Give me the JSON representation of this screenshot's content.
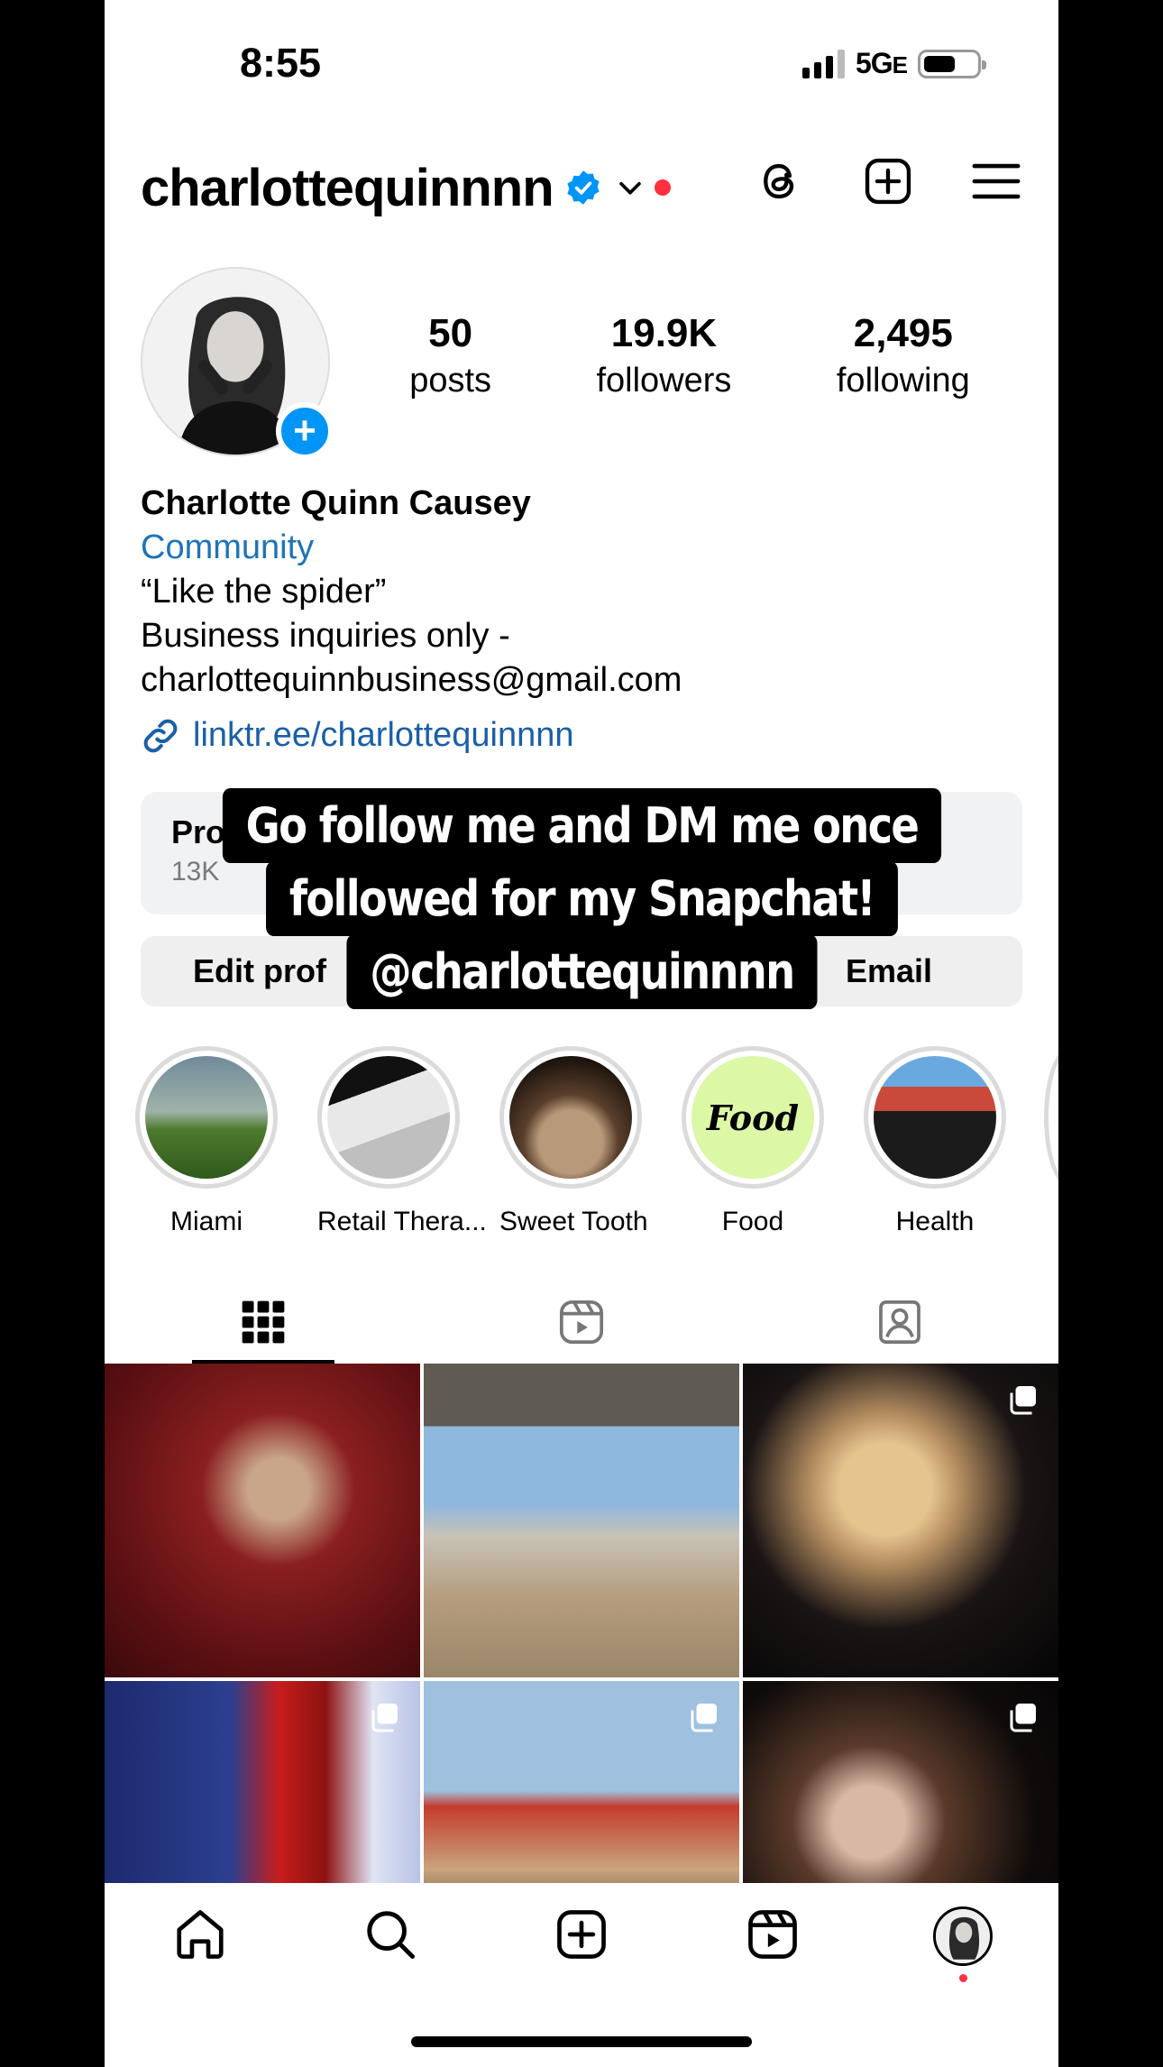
{
  "status_bar": {
    "time": "8:55",
    "network": "5G",
    "network_suffix": "E"
  },
  "header": {
    "username": "charlottequinnnn"
  },
  "stats": [
    {
      "value": "50",
      "label": "posts"
    },
    {
      "value": "19.9K",
      "label": "followers"
    },
    {
      "value": "2,495",
      "label": "following"
    }
  ],
  "bio": {
    "name": "Charlotte Quinn Causey",
    "category": "Community",
    "line1": "“Like the spider”",
    "line2": "Business inquiries only -",
    "line3": "charlottequinnbusiness@gmail.com",
    "link": "linktr.ee/charlottequinnnn"
  },
  "dashboard": {
    "title": "Pro",
    "subtitle": "13K"
  },
  "buttons": {
    "edit": "Edit prof",
    "email": "Email"
  },
  "sticker": {
    "line1": "Go follow me and DM me once",
    "line2": "followed for my Snapchat!",
    "line3": "@charlottequinnnn"
  },
  "highlights": [
    {
      "label": "Miami"
    },
    {
      "label": "Retail Thera..."
    },
    {
      "label": "Sweet Tooth"
    },
    {
      "label": "Food",
      "cover_text": "Food"
    },
    {
      "label": "Health"
    }
  ],
  "colors": {
    "accent": "#0095f6",
    "link": "#1a5fa8",
    "notification": "#ff3040"
  }
}
